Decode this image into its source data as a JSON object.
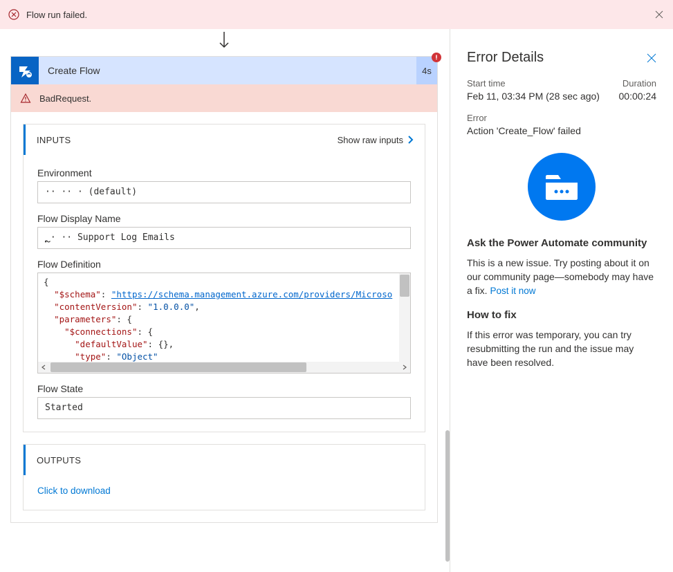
{
  "alert": {
    "text": "Flow run failed.",
    "icon": "error-circle-icon",
    "close_icon": "close-icon"
  },
  "action": {
    "title": "Create Flow",
    "time": "4s",
    "icon": "flow-icon",
    "error_badge_icon": "alert-badge-icon",
    "error_label": "BadRequest.",
    "warn_icon": "warning-icon"
  },
  "inputs": {
    "section_title": "INPUTS",
    "show_raw_label": "Show raw inputs",
    "fields": {
      "environment": {
        "label": "Environment",
        "value": "·· ·· ·   (default)"
      },
      "flow_display_name": {
        "label": "Flow Display Name",
        "value": "ຼ · ·· Support Log Emails"
      },
      "flow_definition": {
        "label": "Flow Definition",
        "json": {
          "schema_key": "\"$schema\"",
          "schema_val": "\"https://schema.management.azure.com/providers/Microso",
          "cv_key": "\"contentVersion\"",
          "cv_val": "\"1.0.0.0\"",
          "params_key": "\"parameters\"",
          "conn_key": "\"$connections\"",
          "dv_key": "\"defaultValue\"",
          "type_key": "\"type\"",
          "type_val": "\"Object\""
        }
      },
      "flow_state": {
        "label": "Flow State",
        "value": "Started"
      }
    }
  },
  "outputs": {
    "section_title": "OUTPUTS",
    "download_label": "Click to download"
  },
  "error_details": {
    "title": "Error Details",
    "start_time_label": "Start time",
    "start_time_value": "Feb 11, 03:34 PM (28 sec ago)",
    "duration_label": "Duration",
    "duration_value": "00:00:24",
    "error_label": "Error",
    "error_value": "Action 'Create_Flow' failed",
    "ask_heading": "Ask the Power Automate community",
    "ask_text_1": "This is a new issue. Try posting about it on our community page—somebody may have a fix. ",
    "post_link": "Post it now",
    "howto_heading": "How to fix",
    "howto_text": "If this error was temporary, you can try resubmitting the run and the issue may have been resolved."
  }
}
